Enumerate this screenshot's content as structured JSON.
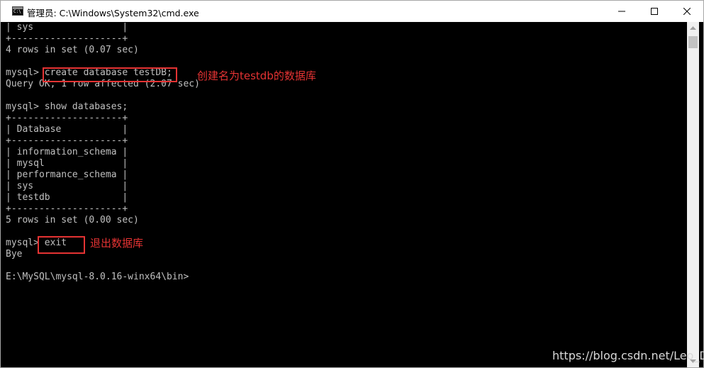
{
  "window": {
    "title": "管理员: C:\\Windows\\System32\\cmd.exe",
    "icon_text": "C:\\"
  },
  "console": {
    "lines": [
      "| sys                |",
      "+--------------------+",
      "4 rows in set (0.07 sec)",
      "",
      "mysql> create database testDB;",
      "Query OK, 1 row affected (2.07 sec)",
      "",
      "mysql> show databases;",
      "+--------------------+",
      "| Database           |",
      "+--------------------+",
      "| information_schema |",
      "| mysql              |",
      "| performance_schema |",
      "| sys                |",
      "| testdb             |",
      "+--------------------+",
      "5 rows in set (0.00 sec)",
      "",
      "mysql> exit",
      "Bye",
      "",
      "E:\\MySQL\\mysql-8.0.16-winx64\\bin>"
    ]
  },
  "annotations": {
    "create_note": "创建名为testdb的数据库",
    "exit_note": "退出数据库"
  },
  "watermark": "https://blog.csdn.net/Leo_D",
  "colors": {
    "terminal_bg": "#000000",
    "terminal_fg": "#c0c0c0",
    "annotation": "#e53333"
  }
}
